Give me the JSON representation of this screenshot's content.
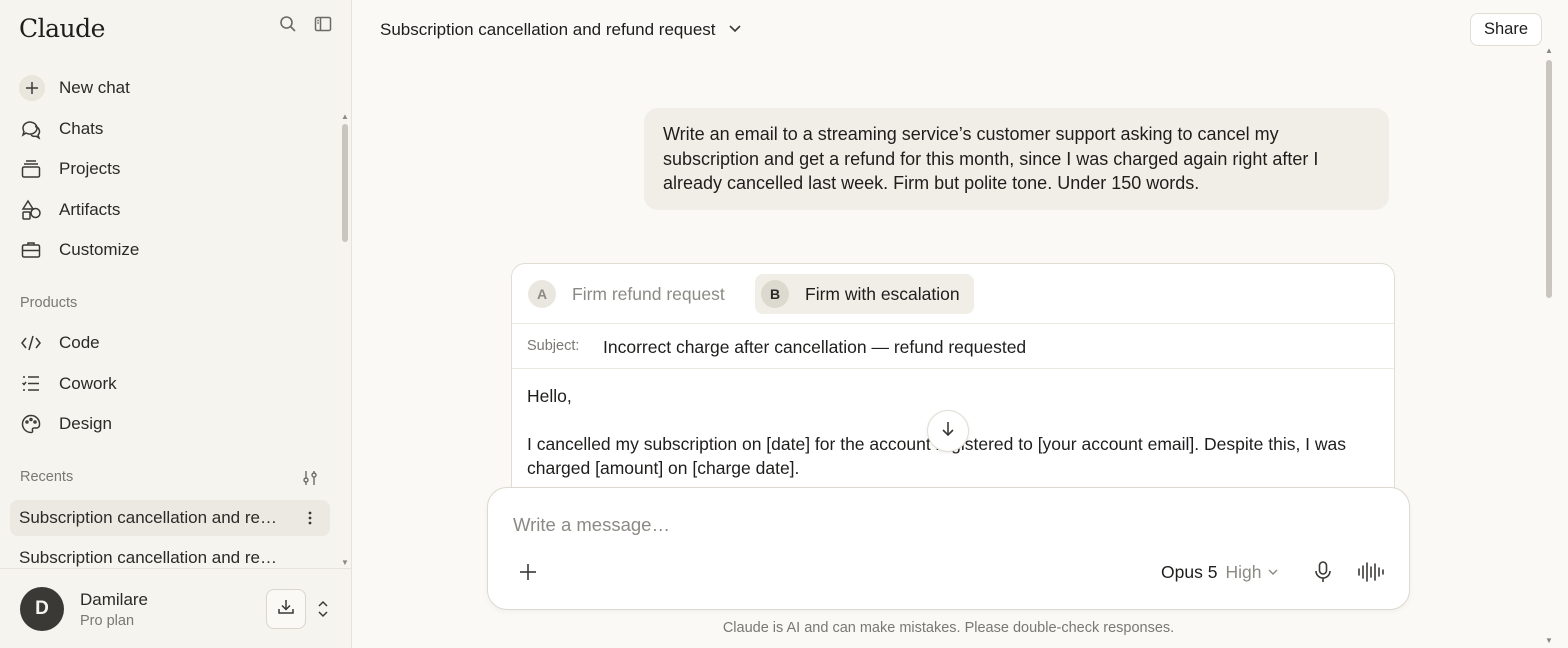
{
  "sidebar": {
    "logo": "Claude",
    "nav": [
      {
        "label": "New chat",
        "icon": "plus-icon"
      },
      {
        "label": "Chats",
        "icon": "chat-bubbles-icon"
      },
      {
        "label": "Projects",
        "icon": "folder-stack-icon"
      },
      {
        "label": "Artifacts",
        "icon": "shapes-icon"
      },
      {
        "label": "Customize",
        "icon": "briefcase-icon"
      }
    ],
    "products_label": "Products",
    "products": [
      {
        "label": "Code",
        "icon": "code-icon"
      },
      {
        "label": "Cowork",
        "icon": "checklist-icon"
      },
      {
        "label": "Design",
        "icon": "palette-icon"
      }
    ],
    "recents_label": "Recents",
    "recents": [
      {
        "label": "Subscription cancellation and re…"
      },
      {
        "label": "Subscription cancellation and re…"
      }
    ],
    "user": {
      "initial": "D",
      "name": "Damilare",
      "plan": "Pro plan"
    }
  },
  "header": {
    "title": "Subscription cancellation and refund request",
    "share_label": "Share"
  },
  "conversation": {
    "user_message": "Write an email to a streaming service’s customer support asking to cancel my subscription and get a refund for this month, since I was charged again right after I already cancelled last week. Firm but polite tone. Under 150 words.",
    "email_card": {
      "tabs": [
        {
          "badge": "A",
          "label": "Firm refund request",
          "active": false
        },
        {
          "badge": "B",
          "label": "Firm with escalation",
          "active": true
        }
      ],
      "subject_label": "Subject:",
      "subject": "Incorrect charge after cancellation — refund requested",
      "greeting": "Hello,",
      "paragraph1": "I cancelled my subscription on [date] for the account registered to [your account email]. Despite this, I was charged [amount] on [charge date]."
    }
  },
  "composer": {
    "placeholder": "Write a message…",
    "model": "Opus 5",
    "effort": "High"
  },
  "disclaimer": "Claude is AI and can make mistakes. Please double-check responses.",
  "colors": {
    "background": "#faf9f5",
    "sidebar": "#f5f4ee",
    "user_bubble": "#f0eee6",
    "text": "#1f1e1d",
    "muted": "#7a7873"
  }
}
